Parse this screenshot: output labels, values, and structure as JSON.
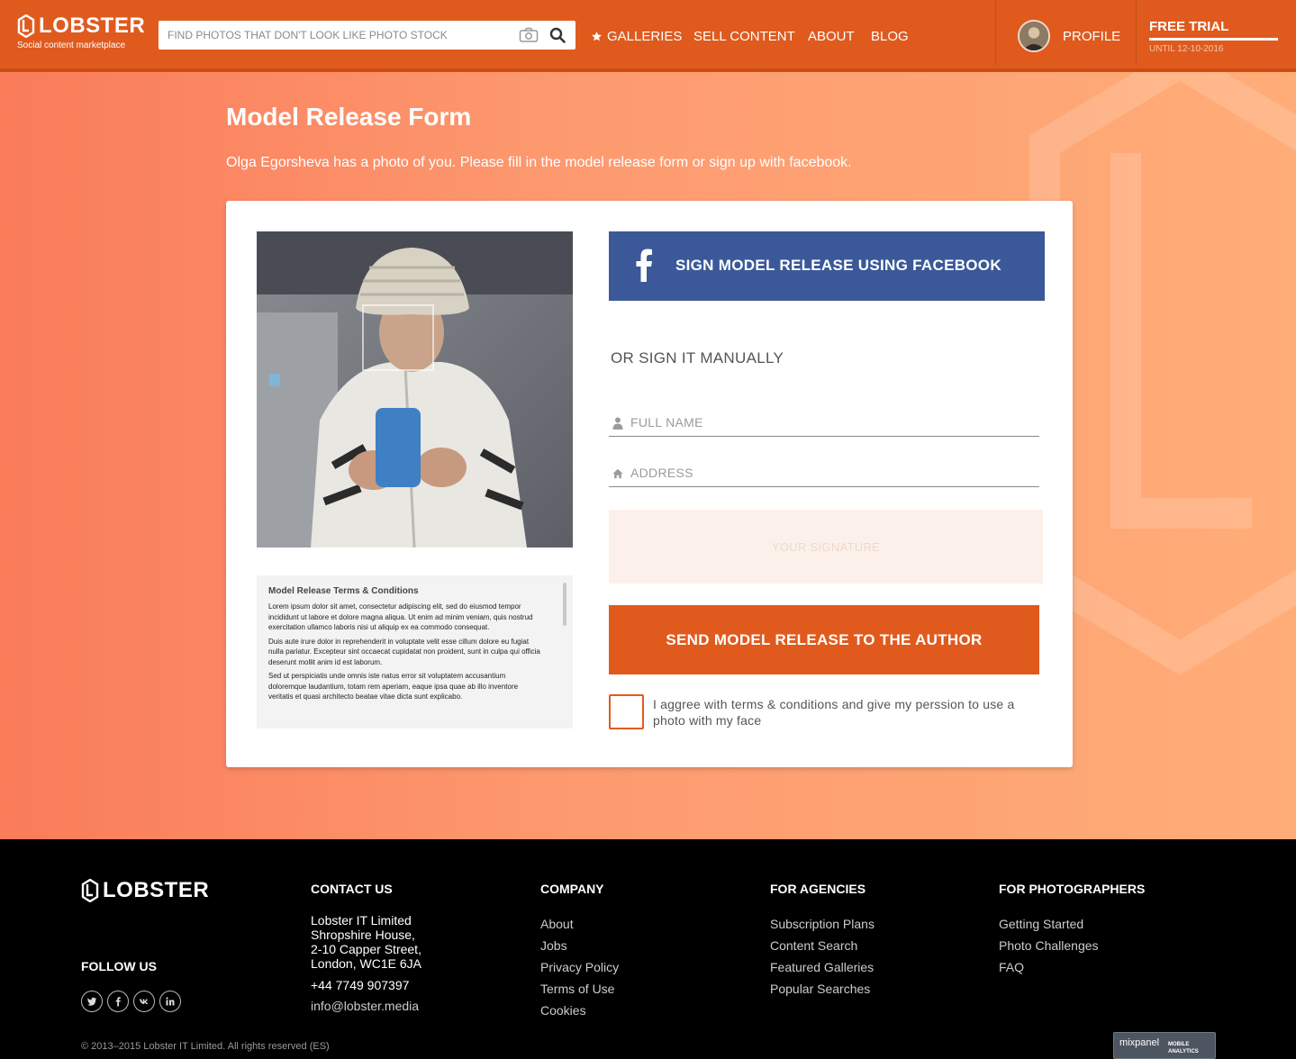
{
  "header": {
    "logo": "LOBSTER",
    "tagline": "Social content marketplace",
    "search_placeholder": "FIND PHOTOS THAT DON'T LOOK LIKE PHOTO STOCK",
    "nav": {
      "galleries": "GALLERIES",
      "sell": "SELL CONTENT",
      "about": "ABOUT",
      "blog": "BLOG"
    },
    "profile": "PROFILE",
    "trial_title": "FREE TRIAL",
    "trial_until": "UNTIL 12-10-2016"
  },
  "page": {
    "title": "Model Release Form",
    "subtitle": "Olga Egorsheva has a photo of you. Please fill in the model release form or sign up with facebook."
  },
  "terms": {
    "title": "Model Release Terms & Conditions",
    "p1": "Lorem ipsum dolor sit amet, consectetur adipiscing elit, sed do eiusmod tempor incididunt ut labore et dolore magna aliqua. Ut enim ad minim veniam, quis nostrud exercitation ullamco laboris nisi ut aliquip ex ea commodo consequat.",
    "p2": "Duis aute irure dolor in reprehenderit in voluptate velit esse cillum dolore eu fugiat nulla pariatur. Excepteur sint occaecat cupidatat non proident, sunt in culpa qui officia deserunt mollit anim id est laborum.",
    "p3": "Sed ut perspiciatis unde omnis iste natus error sit voluptatem accusantium doloremque laudantium, totam rem aperiam, eaque ipsa quae ab illo inventore veritatis et quasi architecto beatae vitae dicta sunt explicabo."
  },
  "form": {
    "facebook_button": "SIGN MODEL RELEASE USING FACEBOOK",
    "or_manual": "OR SIGN IT MANUALLY",
    "full_name_placeholder": "FULL NAME",
    "address_placeholder": "ADDRESS",
    "signature_placeholder": "YOUR SIGNATURE",
    "send_button": "SEND MODEL RELEASE TO THE AUTHOR",
    "agree_text": "I aggree with terms & conditions and give my perssion to use a photo with my face"
  },
  "footer": {
    "logo": "LOBSTER",
    "follow_us": "FOLLOW US",
    "contact": {
      "heading": "CONTACT US",
      "company": "Lobster IT Limited",
      "line1": "Shropshire House,",
      "line2": "2-10 Capper Street,",
      "line3": "London, WC1E 6JA",
      "phone": "+44 7749 907397",
      "email": "info@lobster.media"
    },
    "company": {
      "heading": "COMPANY",
      "links": [
        "About",
        "Jobs",
        "Privacy Policy",
        "Terms of Use",
        "Cookies"
      ]
    },
    "agencies": {
      "heading": "FOR AGENCIES",
      "links": [
        "Subscription Plans",
        "Content Search",
        "Featured Galleries",
        "Popular Searches"
      ]
    },
    "photographers": {
      "heading": "FOR PHOTOGRAPHERS",
      "links": [
        "Getting Started",
        "Photo Challenges",
        "FAQ"
      ]
    },
    "copyright": "© 2013–2015 Lobster IT Limited. All rights reserved (ES)",
    "mixpanel_main": "mixpanel",
    "mixpanel_small": "MOBILE ANALYTICS"
  },
  "colors": {
    "brand_orange": "#e05a1e",
    "facebook_blue": "#3b5998",
    "footer_bg": "#000000"
  },
  "icons": [
    "lobster-logo-icon",
    "camera-icon",
    "search-icon",
    "star-icon",
    "facebook-icon",
    "user-icon",
    "home-icon",
    "twitter-icon",
    "vk-icon",
    "linkedin-icon"
  ]
}
